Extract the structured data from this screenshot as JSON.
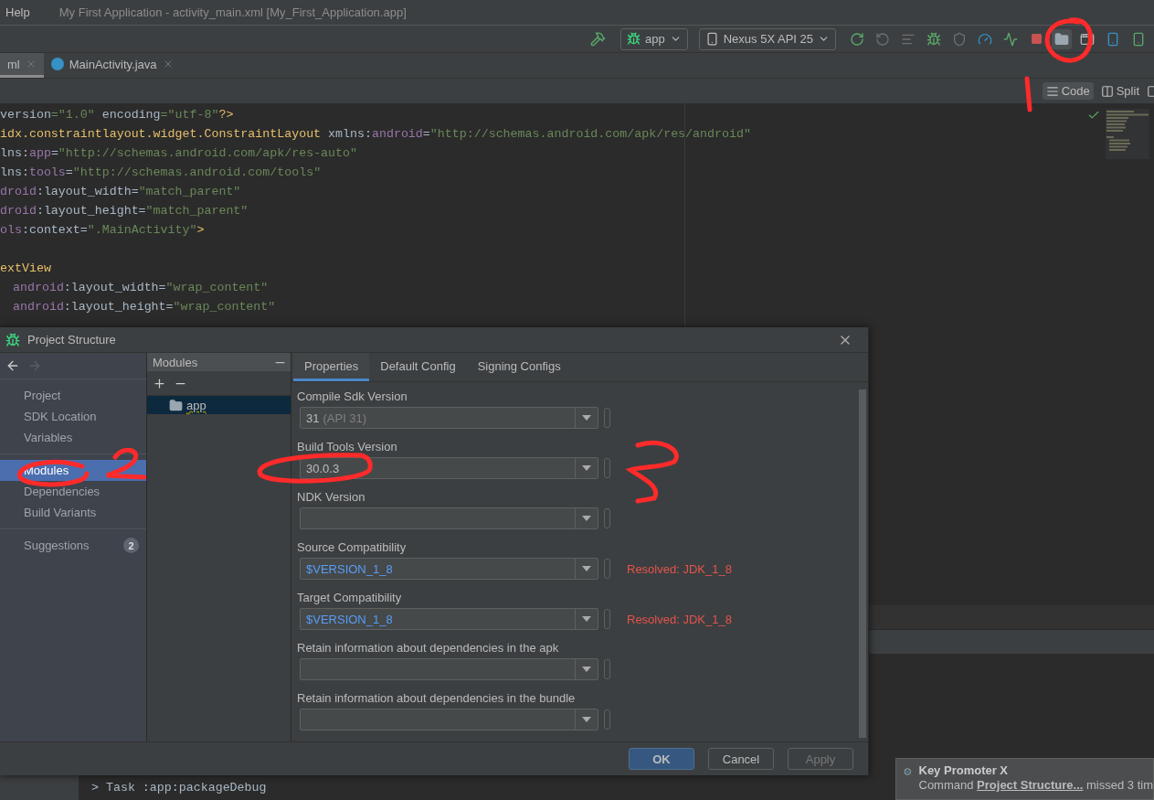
{
  "window": {
    "menu": [
      "Help"
    ],
    "title": "My First Application - activity_main.xml [My_First_Application.app]"
  },
  "toolbar": {
    "configuration": "app",
    "device": "Nexus 5X API 25"
  },
  "editor_tabs": [
    {
      "label": "ml",
      "selected": true
    },
    {
      "label": "MainActivity.java",
      "selected": false
    }
  ],
  "view_modes": [
    {
      "label": "Code",
      "selected": true
    },
    {
      "label": "Split",
      "selected": false
    }
  ],
  "code_lines": [
    {
      "kind": "code",
      "tokens": [
        {
          "kind": "plain",
          "text": "version"
        },
        {
          "kind": "value",
          "text": "=\"1.0\""
        },
        {
          "kind": "plain",
          "text": " encoding"
        },
        {
          "kind": "value",
          "text": "=\"utf-8\""
        },
        {
          "kind": "tag",
          "text": "?>"
        }
      ]
    },
    {
      "kind": "code",
      "tokens": [
        {
          "kind": "tag",
          "text": "idx.constraintlayout.widget.ConstraintLayout"
        },
        {
          "kind": "plain",
          "text": " xmlns:"
        },
        {
          "kind": "ns",
          "text": "android"
        },
        {
          "kind": "plain",
          "text": "="
        },
        {
          "kind": "value",
          "text": "\"http://schemas.android.com/apk/res/android\""
        }
      ]
    },
    {
      "kind": "code",
      "tokens": [
        {
          "kind": "plain",
          "text": "lns:"
        },
        {
          "kind": "ns",
          "text": "app"
        },
        {
          "kind": "plain",
          "text": "="
        },
        {
          "kind": "value",
          "text": "\"http://schemas.android.com/apk/res-auto\""
        }
      ]
    },
    {
      "kind": "code",
      "tokens": [
        {
          "kind": "plain",
          "text": "lns:"
        },
        {
          "kind": "ns",
          "text": "tools"
        },
        {
          "kind": "plain",
          "text": "="
        },
        {
          "kind": "value",
          "text": "\"http://schemas.android.com/tools\""
        }
      ]
    },
    {
      "kind": "code",
      "tokens": [
        {
          "kind": "ns",
          "text": "droid"
        },
        {
          "kind": "plain",
          "text": ":layout_width="
        },
        {
          "kind": "value",
          "text": "\"match_parent\""
        }
      ]
    },
    {
      "kind": "code",
      "tokens": [
        {
          "kind": "ns",
          "text": "droid"
        },
        {
          "kind": "plain",
          "text": ":layout_height="
        },
        {
          "kind": "value",
          "text": "\"match_parent\""
        }
      ]
    },
    {
      "kind": "code",
      "tokens": [
        {
          "kind": "ns",
          "text": "ols"
        },
        {
          "kind": "plain",
          "text": ":context="
        },
        {
          "kind": "value",
          "text": "\".MainActivity\""
        },
        {
          "kind": "tag",
          "text": ">"
        }
      ]
    },
    {
      "kind": "blank"
    },
    {
      "kind": "code",
      "tokens": [
        {
          "kind": "tag",
          "text": "extView"
        }
      ]
    },
    {
      "kind": "code",
      "indented": true,
      "tokens": [
        {
          "kind": "ns",
          "text": "android"
        },
        {
          "kind": "plain",
          "text": ":layout_width="
        },
        {
          "kind": "value",
          "text": "\"wrap_content\""
        }
      ]
    },
    {
      "kind": "code",
      "indented": true,
      "tokens": [
        {
          "kind": "ns",
          "text": "android"
        },
        {
          "kind": "plain",
          "text": ":layout_height="
        },
        {
          "kind": "value",
          "text": "\"wrap_content\""
        }
      ]
    }
  ],
  "console": {
    "line": "> Task :app:packageDebug"
  },
  "dialog": {
    "title": "Project Structure",
    "history": {
      "back_enabled": true,
      "forward_enabled": false
    },
    "nav_groups": [
      {
        "items": [
          {
            "label": "Project",
            "selected": false
          },
          {
            "label": "SDK Location",
            "selected": false
          },
          {
            "label": "Variables",
            "selected": false
          }
        ]
      },
      {
        "items": [
          {
            "label": "Modules",
            "selected": true
          },
          {
            "label": "Dependencies",
            "selected": false
          },
          {
            "label": "Build Variants",
            "selected": false
          }
        ]
      },
      {
        "items": [
          {
            "label": "Suggestions",
            "selected": false,
            "badge": "2"
          }
        ]
      }
    ],
    "modules": {
      "header": "Modules",
      "items": [
        {
          "label": "app",
          "selected": true
        }
      ]
    },
    "tabs": [
      {
        "label": "Properties",
        "selected": true
      },
      {
        "label": "Default Config",
        "selected": false
      },
      {
        "label": "Signing Configs",
        "selected": false
      }
    ],
    "fields": [
      {
        "label": "Compile Sdk Version",
        "kind": "literal",
        "value": "31",
        "note": "(API 31)"
      },
      {
        "label": "Build Tools Version",
        "kind": "literal",
        "value": "30.0.3"
      },
      {
        "label": "NDK Version"
      },
      {
        "label": "Source Compatibility",
        "kind": "variable",
        "value": "$VERSION_1_8",
        "resolved": "Resolved: JDK_1_8"
      },
      {
        "label": "Target Compatibility",
        "kind": "variable",
        "value": "$VERSION_1_8",
        "resolved": "Resolved: JDK_1_8"
      },
      {
        "label": "Retain information about dependencies in the apk"
      },
      {
        "label": "Retain information about dependencies in the bundle"
      }
    ],
    "buttons": [
      {
        "label": "OK",
        "kind": "default",
        "disabled": false
      },
      {
        "label": "Cancel",
        "kind": "normal",
        "disabled": false
      },
      {
        "label": "Apply",
        "kind": "normal",
        "disabled": true
      }
    ]
  },
  "notification": {
    "title": "Key Promoter X",
    "text_before": "Command",
    "link": "Project Structure...",
    "text_after": "missed 3 tim"
  }
}
